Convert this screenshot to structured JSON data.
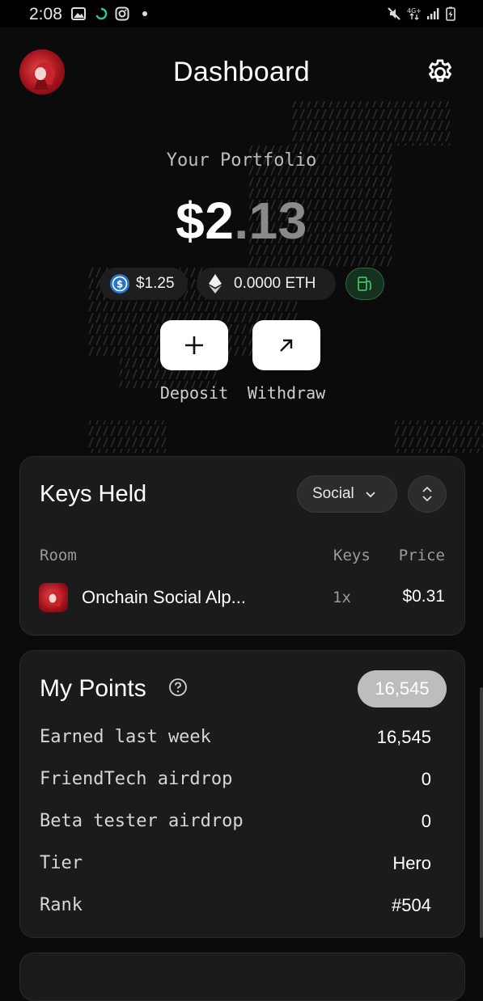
{
  "status_bar": {
    "time": "2:08",
    "icons": [
      "image-icon",
      "sync-icon",
      "instagram-icon",
      "dot-icon",
      "mute-icon",
      "4g-icon",
      "signal-icon",
      "battery-charging-icon"
    ],
    "network": "4G+"
  },
  "header": {
    "title": "Dashboard",
    "avatar_icon": "avatar",
    "settings_icon": "gear-icon"
  },
  "portfolio": {
    "label": "Your Portfolio",
    "amount_whole": "$2",
    "amount_decimal": ".13",
    "usdc_balance": "$1.25",
    "eth_balance": "0.0000 ETH",
    "gas_icon": "gas-pump-icon"
  },
  "actions": {
    "deposit_label": "Deposit",
    "withdraw_label": "Withdraw"
  },
  "keys_held": {
    "title": "Keys Held",
    "filter_value": "Social",
    "columns": {
      "room": "Room",
      "keys": "Keys",
      "price": "Price"
    },
    "rows": [
      {
        "room": "Onchain Social Alp...",
        "keys": "1x",
        "price": "$0.31"
      }
    ]
  },
  "my_points": {
    "title": "My Points",
    "total_badge": "16,545",
    "rows": [
      {
        "label": "Earned last week",
        "value": "16,545"
      },
      {
        "label": "FriendTech airdrop",
        "value": "0"
      },
      {
        "label": "Beta tester airdrop",
        "value": "0"
      },
      {
        "label": "Tier",
        "value": "Hero"
      },
      {
        "label": "Rank",
        "value": "#504"
      }
    ]
  },
  "colors": {
    "background": "#0b0b0b",
    "card": "#1b1b1b",
    "gas_green": "#3fbf5f",
    "usdc_blue": "#2775ca"
  }
}
